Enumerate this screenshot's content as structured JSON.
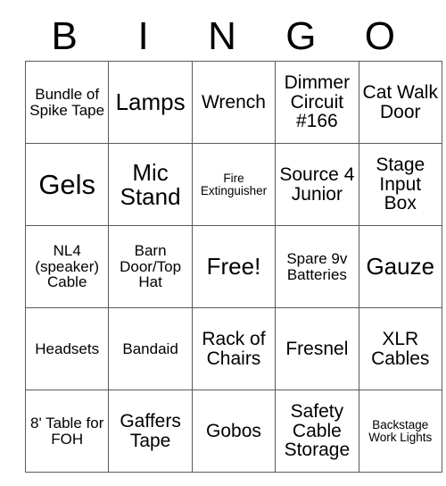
{
  "card": {
    "header_letters": [
      "B",
      "I",
      "N",
      "G",
      "O"
    ],
    "rows": [
      [
        {
          "text": "Bundle of Spike Tape",
          "size": "sm"
        },
        {
          "text": "Lamps",
          "size": "lg"
        },
        {
          "text": "Wrench",
          "size": "md"
        },
        {
          "text": "Dimmer Circuit #166",
          "size": "md"
        },
        {
          "text": "Cat Walk Door",
          "size": "md"
        }
      ],
      [
        {
          "text": "Gels",
          "size": "xl"
        },
        {
          "text": "Mic Stand",
          "size": "lg"
        },
        {
          "text": "Fire Extinguisher",
          "size": "xs"
        },
        {
          "text": "Source 4 Junior",
          "size": "md"
        },
        {
          "text": "Stage Input Box",
          "size": "md"
        }
      ],
      [
        {
          "text": "NL4 (speaker) Cable",
          "size": "sm"
        },
        {
          "text": "Barn Door/Top Hat",
          "size": "sm"
        },
        {
          "text": "Free!",
          "size": "lg"
        },
        {
          "text": "Spare 9v Batteries",
          "size": "sm"
        },
        {
          "text": "Gauze",
          "size": "lg"
        }
      ],
      [
        {
          "text": "Headsets",
          "size": "sm"
        },
        {
          "text": "Bandaid",
          "size": "sm"
        },
        {
          "text": "Rack of Chairs",
          "size": "md"
        },
        {
          "text": "Fresnel",
          "size": "md"
        },
        {
          "text": "XLR Cables",
          "size": "md"
        }
      ],
      [
        {
          "text": "8' Table for FOH",
          "size": "sm"
        },
        {
          "text": "Gaffers Tape",
          "size": "md"
        },
        {
          "text": "Gobos",
          "size": "md"
        },
        {
          "text": "Safety Cable Storage",
          "size": "md"
        },
        {
          "text": "Backstage Work Lights",
          "size": "xs"
        }
      ]
    ],
    "free_space": {
      "row": 2,
      "column": 2,
      "label": "Free!"
    },
    "colors": {
      "background": "#ffffff",
      "text": "#000000",
      "grid_line": "#5a5a5a"
    }
  }
}
